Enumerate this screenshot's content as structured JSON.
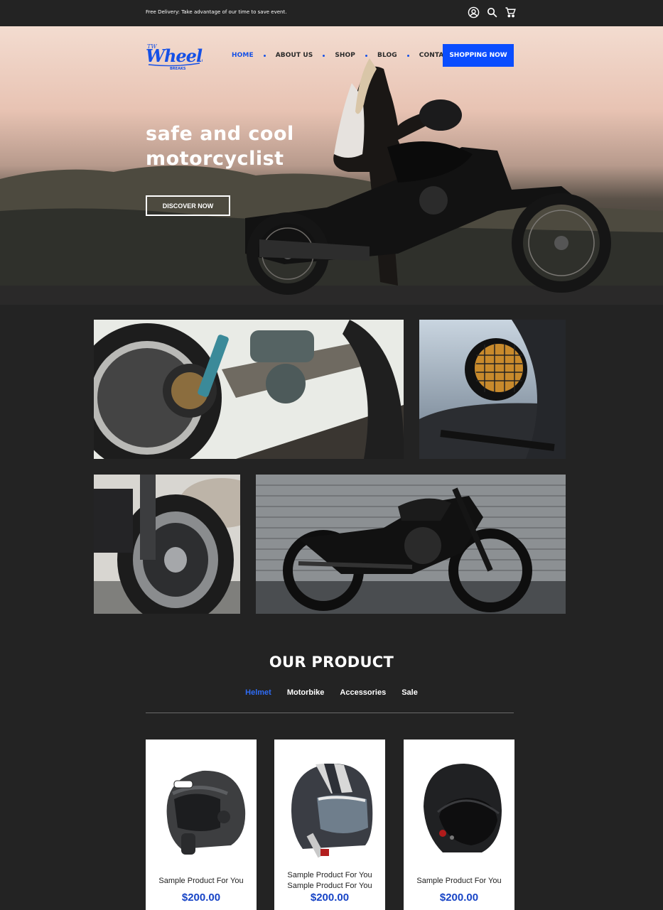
{
  "topbar": {
    "promo_text": "Free Delivery: Take advantage of our time to save event.",
    "icons": [
      "account-icon",
      "search-icon",
      "cart-icon"
    ]
  },
  "header": {
    "logo_text": "Wheels",
    "nav": [
      {
        "label": "HOME",
        "active": true
      },
      {
        "label": "ABOUT US",
        "active": false
      },
      {
        "label": "SHOP",
        "active": false
      },
      {
        "label": "BLOG",
        "active": false
      },
      {
        "label": "CONTACT",
        "active": false
      }
    ],
    "cta_label": "SHOPPING NOW"
  },
  "hero": {
    "title_line1": "safe and cool",
    "title_line2": "motorcyclist",
    "button_label": "DISCOVER NOW"
  },
  "products": {
    "title": "OUR PRODUCT",
    "tabs": [
      {
        "label": "Helmet",
        "active": true
      },
      {
        "label": "Motorbike",
        "active": false
      },
      {
        "label": "Accessories",
        "active": false
      },
      {
        "label": "Sale",
        "active": false
      }
    ],
    "items": [
      {
        "name": "Sample Product For You",
        "price": "$200.00"
      },
      {
        "name": "Sample Product For You Sample Product For You",
        "name_line1": "Sample Product For You",
        "name_line2": "Sample Product For You",
        "price": "$200.00"
      },
      {
        "name": "Sample Product For You",
        "price": "$200.00"
      }
    ]
  },
  "colors": {
    "accent": "#0a4dff",
    "nav_active": "#1550e6",
    "tab_active": "#2f6cf5",
    "price": "#1744c6",
    "background": "#232323"
  }
}
